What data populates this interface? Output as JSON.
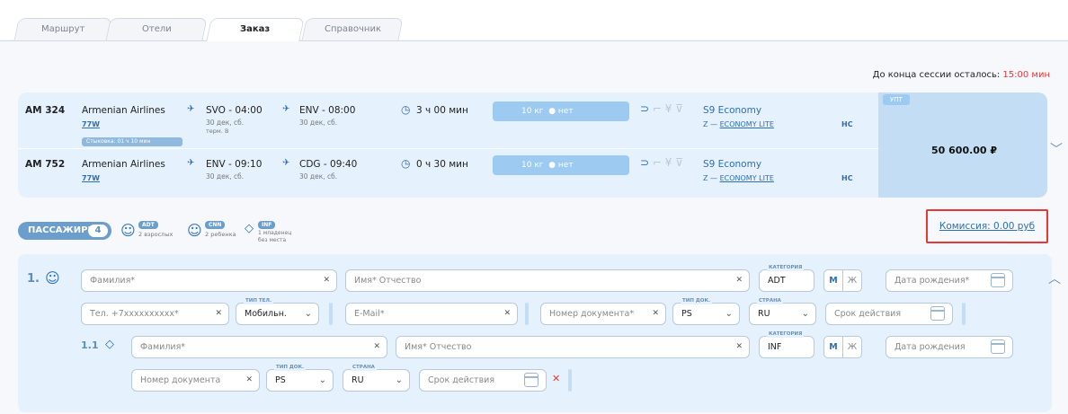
{
  "tabs": [
    "Маршрут",
    "Отели",
    "Заказ",
    "Справочник"
  ],
  "timer": {
    "label": "До конца сессии осталось:",
    "value": "15:00 мин"
  },
  "flights": [
    {
      "flight_no": "AM 324",
      "airline": "Armenian Airlines",
      "airline_code": "77W",
      "dep": "SVO - 04:00",
      "dep_date": "30 дек, сб.",
      "dep_term": "терм. B",
      "arr": "ENV - 08:00",
      "arr_date": "30 дек, сб.",
      "duration": "3 ч 00 мин",
      "bag": "10 кг",
      "bag2": "нет",
      "fare": "S9 Economy",
      "fare_code": "Z —",
      "fare_link": "ECONOMY LITE",
      "ns": "НС"
    },
    {
      "flight_no": "AM 752",
      "airline": "Armenian Airlines",
      "airline_code": "77W",
      "dep": "ENV - 09:10",
      "dep_date": "30 дек, сб.",
      "arr": "CDG - 09:40",
      "arr_date": "30 дек, сб.",
      "duration": "0 ч 30 мин",
      "bag": "10 кг",
      "bag2": "нет",
      "fare": "S9 Economy",
      "fare_code": "Z —",
      "fare_link": "ECONOMY LITE",
      "ns": "НС"
    }
  ],
  "connection": "Стыковка: 01 ч 10 мин",
  "upt": "УПТ",
  "price": "50 600.00 ₽",
  "passengers": {
    "label": "ПАССАЖИРЫ:",
    "count": "4",
    "adt": {
      "badge": "ADT",
      "text": "2 взрослых"
    },
    "cnn": {
      "badge": "CNN",
      "text": "2 ребенка"
    },
    "inf": {
      "badge": "INF",
      "text1": "1 младенец",
      "text2": "без места"
    }
  },
  "commission": "Комиссия: 0.00 руб",
  "form": {
    "num1": "1.",
    "num11": "1.1",
    "surname": "Фамилия*",
    "name": "Имя* Отчество",
    "cat_label": "КАТЕГОРИЯ",
    "cat1": "ADT",
    "cat2": "INF",
    "m": "М",
    "f": "Ж",
    "dob": "Дата рождения*",
    "dob2": "Дата рождения",
    "phone": "Тел. +7xxxxxxxxxx*",
    "phone_type_label": "ТИП ТЕЛ.",
    "phone_type": "Мобильн.",
    "email": "E-Mail*",
    "docnum": "Номер документа*",
    "docnum2": "Номер документа",
    "doctype_label": "ТИП ДОК.",
    "doctype": "PS",
    "country_label": "СТРАНА",
    "country": "RU",
    "expiry": "Срок действия"
  }
}
